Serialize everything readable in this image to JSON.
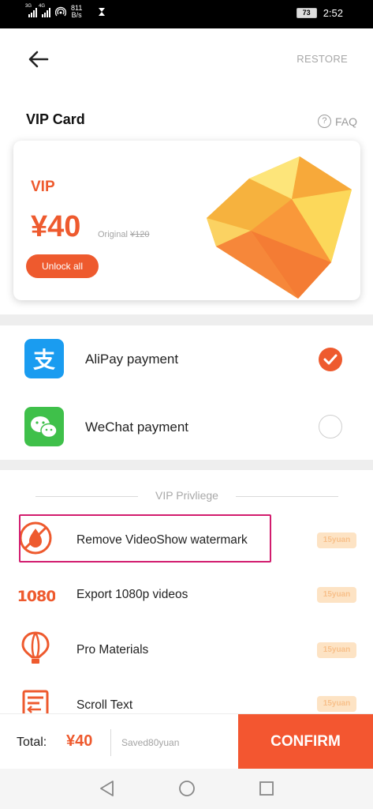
{
  "status_bar": {
    "signal_1_tag": "3G",
    "signal_2_tag": "4G",
    "net_speed_value": "811",
    "net_speed_unit": "B/s",
    "battery": "73",
    "time": "2:52"
  },
  "header": {
    "restore_label": "RESTORE"
  },
  "vip_section": {
    "title": "VIP Card",
    "faq_label": "FAQ",
    "faq_symbol": "?"
  },
  "card": {
    "tier": "VIP",
    "price": "¥40",
    "original_prefix": "Original",
    "original_price": "¥120",
    "unlock_label": "Unlock all"
  },
  "payments": {
    "items": [
      {
        "label": "AliPay payment",
        "icon": "alipay-icon",
        "selected": true
      },
      {
        "label": "WeChat payment",
        "icon": "wechat-icon",
        "selected": false
      }
    ]
  },
  "privileges": {
    "header": "VIP Privliege",
    "items": [
      {
        "label": "Remove VideoShow watermark",
        "badge": "15yuan",
        "icon": "no-watermark-icon"
      },
      {
        "label": "Export 1080p videos",
        "badge": "15yuan",
        "icon": "1080-icon"
      },
      {
        "label": "Pro Materials",
        "badge": "15yuan",
        "icon": "balloon-icon"
      },
      {
        "label": "Scroll Text",
        "badge": "15yuan",
        "icon": "scroll-text-icon"
      }
    ]
  },
  "bottom_bar": {
    "total_label": "Total:",
    "total_value": "¥40",
    "saved_label": "Saved80yuan",
    "confirm_label": "CONFIRM"
  },
  "colors": {
    "accent": "#ee5a2e",
    "confirm_bg": "#f35630",
    "badge_bg": "#fde3c4",
    "highlight": "#d21c6e",
    "alipay": "#1a9cf0",
    "wechat": "#3fc04a"
  }
}
